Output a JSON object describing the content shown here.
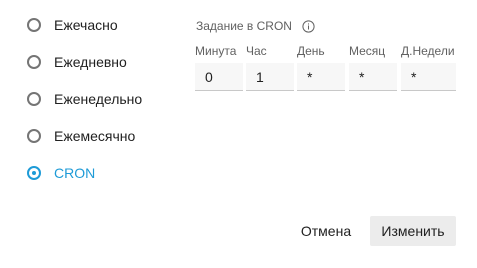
{
  "schedule": {
    "options": [
      {
        "label": "Ежечасно",
        "checked": false
      },
      {
        "label": "Ежедневно",
        "checked": false
      },
      {
        "label": "Еженедельно",
        "checked": false
      },
      {
        "label": "Ежемесячно",
        "checked": false
      },
      {
        "label": "CRON",
        "checked": true
      }
    ]
  },
  "cron": {
    "title": "Задание в CRON",
    "info_icon": "info-icon",
    "fields": [
      {
        "label": "Минута",
        "value": "0"
      },
      {
        "label": "Час",
        "value": "1"
      },
      {
        "label": "День",
        "value": "*"
      },
      {
        "label": "Месяц",
        "value": "*"
      },
      {
        "label": "Д.Недели",
        "value": "*"
      }
    ]
  },
  "actions": {
    "cancel_label": "Отмена",
    "submit_label": "Изменить"
  },
  "colors": {
    "accent": "#1e9bd7",
    "radio_border": "#757575",
    "field_background": "#f7f7f7",
    "submit_background": "#ececec"
  }
}
